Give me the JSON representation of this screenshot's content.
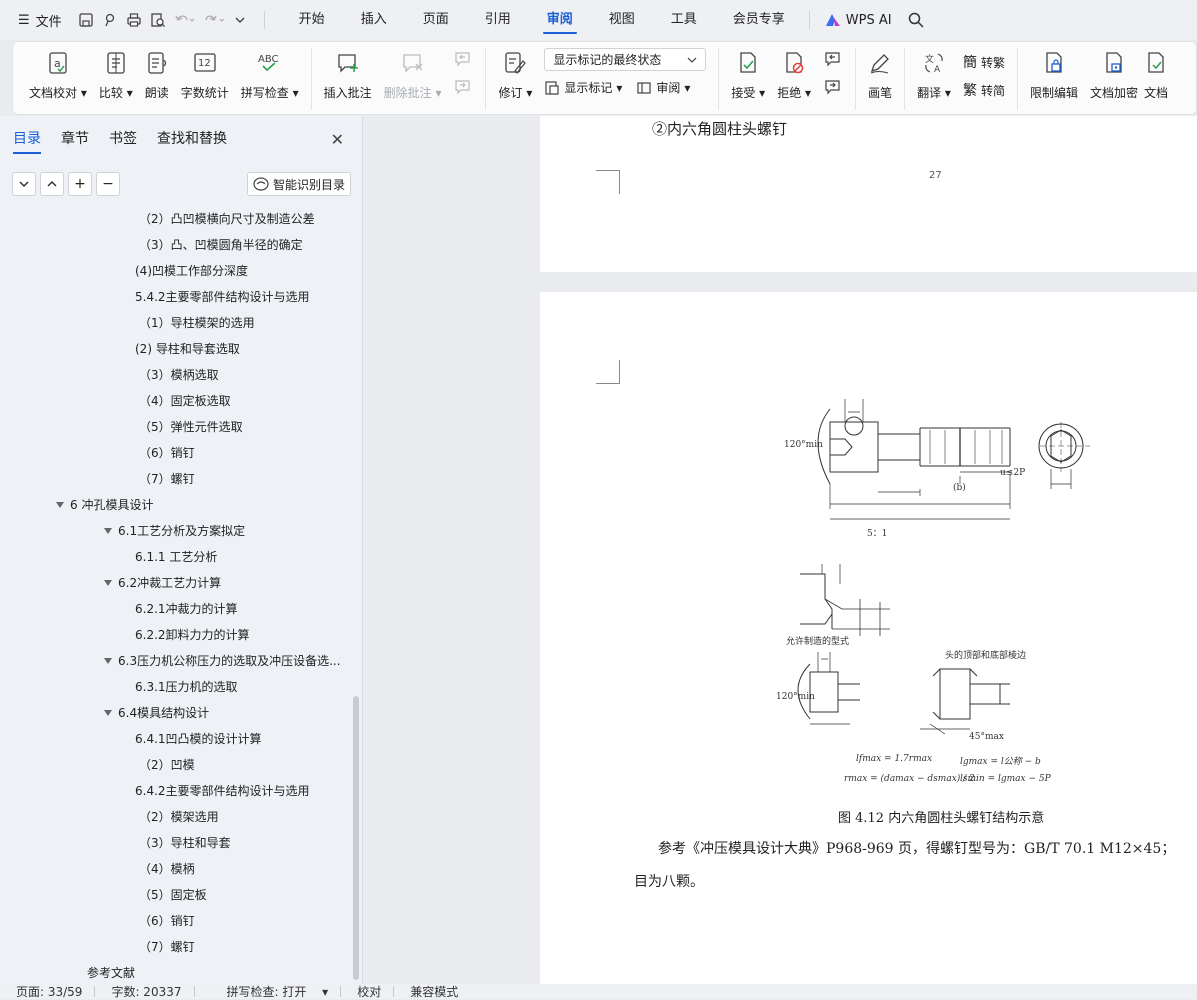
{
  "menubar": {
    "file_label": "文件",
    "tabs": [
      "开始",
      "插入",
      "页面",
      "引用",
      "审阅",
      "视图",
      "工具",
      "会员专享"
    ],
    "active_tab": "审阅",
    "ai_label": "WPS AI"
  },
  "ribbon": {
    "doc_check": "文档校对",
    "compare": "比较",
    "read_aloud": "朗读",
    "word_count": "字数统计",
    "spell_check": "拼写检查",
    "insert_comment": "插入批注",
    "delete_comment": "删除批注",
    "track_changes": "修订",
    "display_mode": "显示标记的最终状态",
    "show_markup": "显示标记",
    "review": "审阅",
    "accept": "接受",
    "reject": "拒绝",
    "pen": "画笔",
    "translate": "翻译",
    "to_traditional": "转繁",
    "to_simplified": "转简",
    "restrict_edit": "限制编辑",
    "doc_encrypt": "文档加密",
    "doc_more": "文档"
  },
  "sidebar": {
    "tabs": [
      "目录",
      "章节",
      "书签",
      "查找和替换"
    ],
    "active_tab": "目录",
    "smart_toc": "智能识别目录",
    "toc": [
      {
        "text": "（2）凸凹模横向尺寸及制造公差",
        "indent": 3
      },
      {
        "text": "（3）凸、凹模圆角半径的确定",
        "indent": 3
      },
      {
        "text": "(4)凹模工作部分深度",
        "indent": 2
      },
      {
        "text": "5.4.2主要零部件结构设计与选用",
        "indent": 2
      },
      {
        "text": "（1）导柱模架的选用",
        "indent": 3
      },
      {
        "text": "(2) 导柱和导套选取",
        "indent": 2
      },
      {
        "text": "（3）模柄选取",
        "indent": 3
      },
      {
        "text": "（4）固定板选取",
        "indent": 3
      },
      {
        "text": "（5）弹性元件选取",
        "indent": 3
      },
      {
        "text": "（6）销钉",
        "indent": 3
      },
      {
        "text": "（7）螺钉",
        "indent": 3
      },
      {
        "text": "6 冲孔模具设计",
        "indent": 0,
        "expand": true
      },
      {
        "text": "6.1工艺分析及方案拟定",
        "indent": 1,
        "expand": true
      },
      {
        "text": "6.1.1 工艺分析",
        "indent": 2
      },
      {
        "text": "6.2冲裁工艺力计算",
        "indent": 1,
        "expand": true
      },
      {
        "text": "6.2.1冲裁力的计算",
        "indent": 2
      },
      {
        "text": "6.2.2卸料力力的计算",
        "indent": 2
      },
      {
        "text": "6.3压力机公称压力的选取及冲压设备选...",
        "indent": 1,
        "expand": true
      },
      {
        "text": "6.3.1压力机的选取",
        "indent": 2
      },
      {
        "text": "6.4模具结构设计",
        "indent": 1,
        "expand": true
      },
      {
        "text": "6.4.1凹凸模的设计计算",
        "indent": 2
      },
      {
        "text": "（2）凹模",
        "indent": 3
      },
      {
        "text": "6.4.2主要零部件结构设计与选用",
        "indent": 2
      },
      {
        "text": "（2）模架选用",
        "indent": 3
      },
      {
        "text": "（3）导柱和导套",
        "indent": 3
      },
      {
        "text": "（4）模柄",
        "indent": 3
      },
      {
        "text": "（5）固定板",
        "indent": 3
      },
      {
        "text": "（6）销钉",
        "indent": 3
      },
      {
        "text": "（7）螺钉",
        "indent": 3
      },
      {
        "text": "参考文献",
        "indent": 4
      }
    ]
  },
  "document": {
    "heading": "②内六角圆柱头螺钉",
    "page_number": "27",
    "figure_caption": "图 4.12 内六角圆柱头螺钉结构示意",
    "paragraph_line1": "参考《冲压模具设计大典》P968-969 页，得螺钉型号为：GB/T 70.1 M12×45；",
    "paragraph_line2": "目为八颗。",
    "drawing_labels": {
      "scale": "5：1",
      "allowed_type": "允许制造的型式",
      "head_edges": "头的顶部和底部棱边",
      "angle1": "120°min",
      "angle2": "120°min",
      "angle3": "45°max",
      "u_label": "u≤2P",
      "b_label": "(b)",
      "f1": "lfmax = 1.7rmax",
      "f2": "rmax = (damax − dsmax) / 2",
      "f3": "lgmax = l公称 − b",
      "f4": "lsmin = lgmax − 5P"
    }
  },
  "status": {
    "page": "页面: 33/59",
    "words": "字数: 20337",
    "spell": "拼写检查: 打开",
    "proof": "校对",
    "compat": "兼容模式"
  }
}
